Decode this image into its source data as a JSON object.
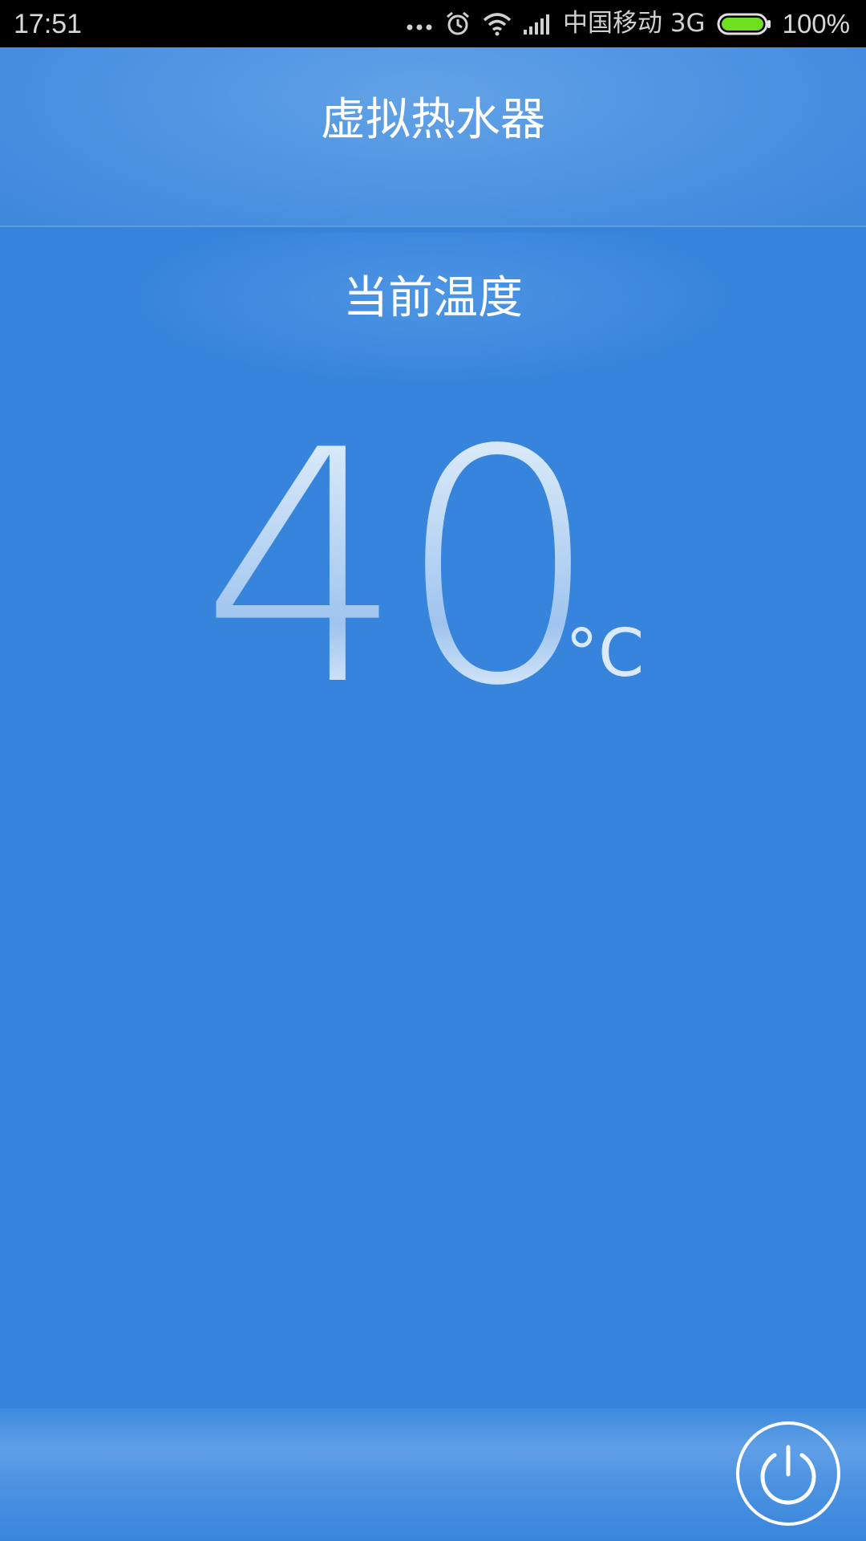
{
  "status_bar": {
    "time": "17:51",
    "carrier": "中国移动 3G",
    "battery_percent": "100%",
    "battery_level": 1.0,
    "icons": [
      "more-dots-icon",
      "alarm-icon",
      "wifi-icon",
      "signal-icon",
      "battery-icon"
    ],
    "battery_color": "#6fe01f"
  },
  "header": {
    "title": "虚拟热水器"
  },
  "main": {
    "label": "当前温度",
    "temperature": "40",
    "unit": "°C"
  },
  "bottom_bar": {
    "power_button_icon": "power-icon"
  },
  "colors": {
    "background": "#3784dc",
    "header": "#4d93e2",
    "text": "#ffffff"
  }
}
